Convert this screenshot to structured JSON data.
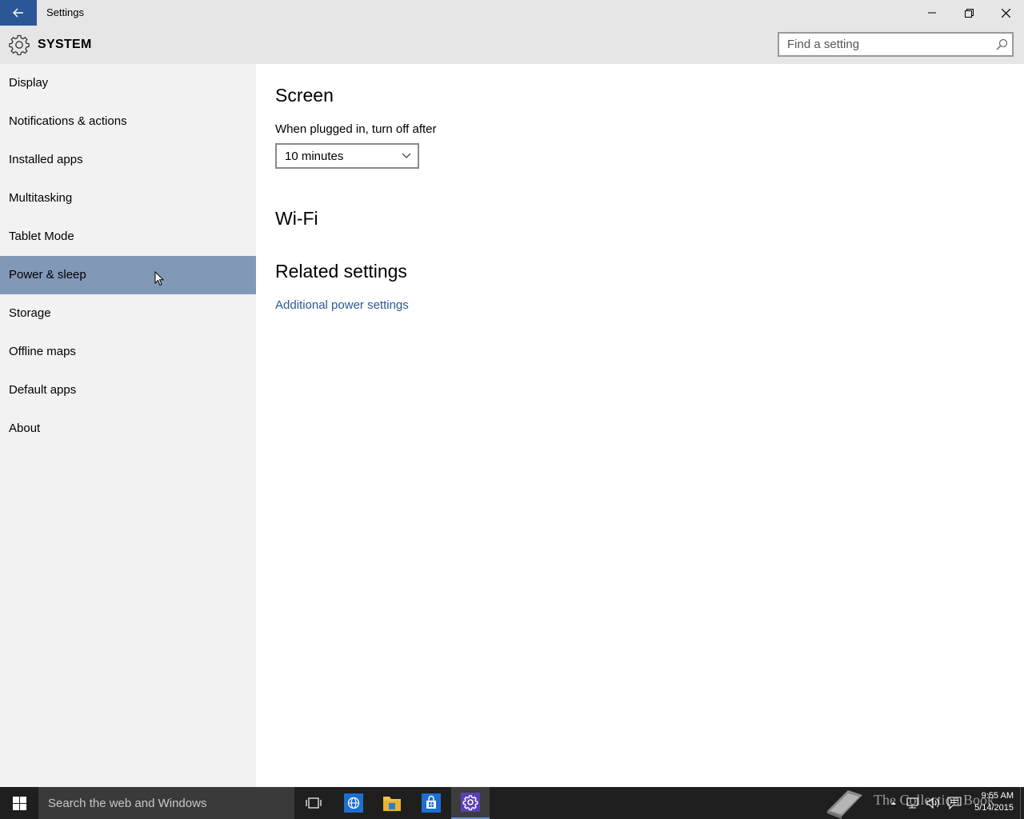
{
  "window": {
    "title": "Settings"
  },
  "header": {
    "section": "SYSTEM",
    "search_placeholder": "Find a setting"
  },
  "sidebar": {
    "items": [
      {
        "label": "Display"
      },
      {
        "label": "Notifications & actions"
      },
      {
        "label": "Installed apps"
      },
      {
        "label": "Multitasking"
      },
      {
        "label": "Tablet Mode"
      },
      {
        "label": "Power & sleep",
        "selected": true
      },
      {
        "label": "Storage"
      },
      {
        "label": "Offline maps"
      },
      {
        "label": "Default apps"
      },
      {
        "label": "About"
      }
    ]
  },
  "main": {
    "screen_heading": "Screen",
    "plugged_label": "When plugged in, turn off after",
    "plugged_value": "10 minutes",
    "wifi_heading": "Wi-Fi",
    "related_heading": "Related settings",
    "power_link": "Additional power settings"
  },
  "taskbar": {
    "search_text": "Search the web and Windows",
    "clock_time": "9:55 AM",
    "clock_date": "5/14/2015",
    "watermark": "The Collection Book"
  },
  "colors": {
    "accent": "#2b5797",
    "selected_item": "#8198b7",
    "sidebar_bg": "#f2f2f2",
    "taskbar_bg": "#1f1f1f"
  }
}
